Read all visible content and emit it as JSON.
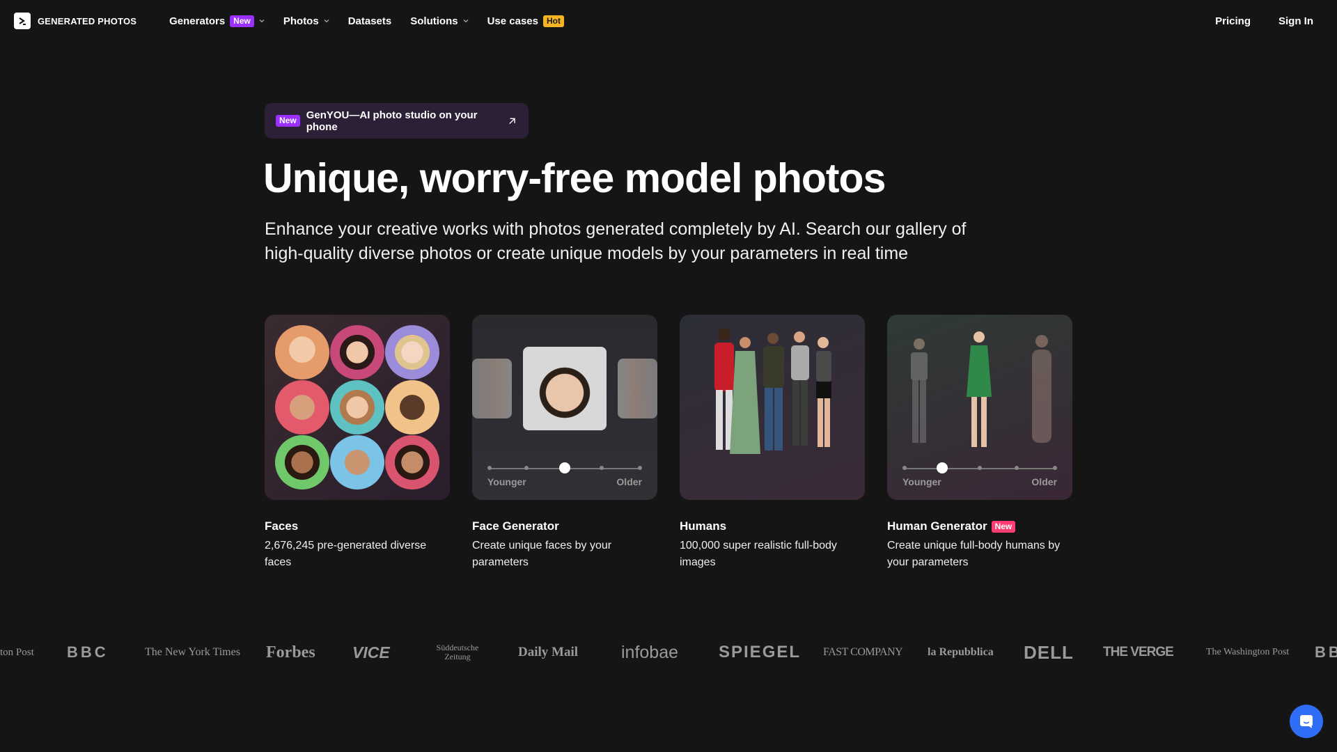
{
  "nav": {
    "logo_text": "GENERATED PHOTOS",
    "items": [
      {
        "label": "Generators",
        "badge": "New"
      },
      {
        "label": "Photos"
      },
      {
        "label": "Datasets"
      },
      {
        "label": "Solutions"
      },
      {
        "label": "Use cases",
        "badge": "Hot"
      }
    ],
    "pricing": "Pricing",
    "signin": "Sign In"
  },
  "promo": {
    "badge": "New",
    "text": "GenYOU—AI photo studio on your phone"
  },
  "hero": {
    "title": "Unique, worry-free model photos",
    "subtitle": "Enhance your creative works with photos generated completely by AI. Search our gallery of high-quality diverse photos or create unique models by your parameters in real time"
  },
  "cards": [
    {
      "title": "Faces",
      "desc": "2,676,245 pre-generated diverse faces"
    },
    {
      "title": "Face Generator",
      "desc": "Create unique faces by your parameters",
      "slider_left": "Younger",
      "slider_right": "Older",
      "slider_value": 0.5
    },
    {
      "title": "Humans",
      "desc": "100,000 super realistic full-body images"
    },
    {
      "title": "Human Generator",
      "badge": "New",
      "desc": "Create unique full-body humans by your parameters",
      "slider_left": "Younger",
      "slider_right": "Older",
      "slider_value": 0.25
    }
  ],
  "press_logos": [
    "ton Post",
    "BBC",
    "The New York Times",
    "Forbes",
    "VICE",
    "Süddeutsche Zeitung",
    "Daily Mail",
    "infobae",
    "SPIEGEL",
    "FAST COMPANY",
    "la Repubblica",
    "DELL",
    "THE VERGE",
    "The Washington Post",
    "BB"
  ],
  "colors": {
    "accent_new": "#9b30ff",
    "hot": "#f6b324",
    "new_pink": "#ff3d73",
    "chat": "#2f6df6"
  }
}
